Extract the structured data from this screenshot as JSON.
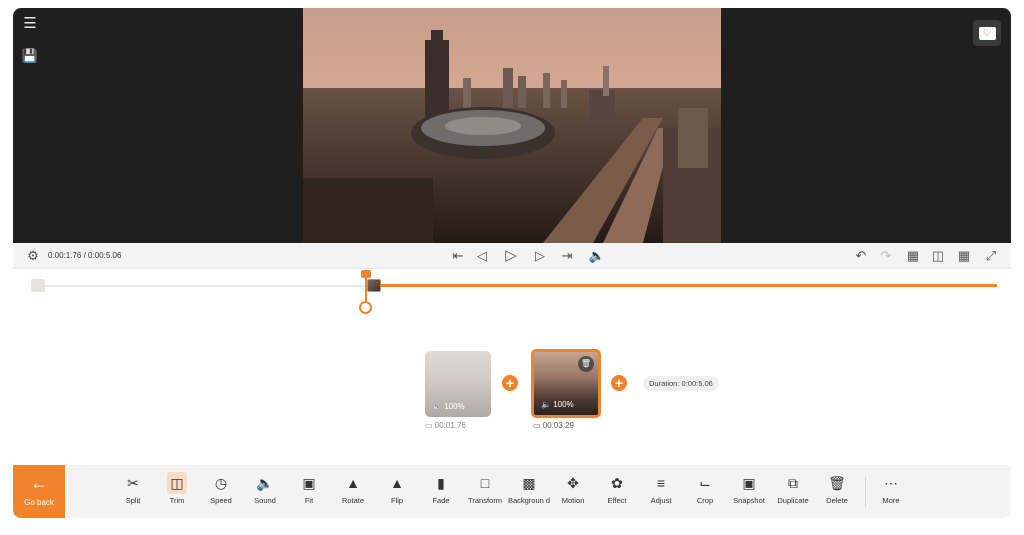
{
  "viewer": {
    "menu_icon": "hamburger-menu-icon",
    "save_icon": "save-icon",
    "feedback_icon": "feedback-heart-icon"
  },
  "controls": {
    "timecode": "0:00:1.76 / 0:00:5.06"
  },
  "timeline": {
    "clips": [
      {
        "volume_label": "100%",
        "duration": "00:01.76",
        "selected": false
      },
      {
        "volume_label": "100%",
        "duration": "00:03.29",
        "selected": true
      }
    ],
    "add_symbol": "+",
    "total_duration": "Duration: 0:00:5.06"
  },
  "toolbar": {
    "go_back_label": "Go back",
    "tools": [
      {
        "label": "Split",
        "icon": "scissors-icon"
      },
      {
        "label": "Trim",
        "icon": "trim-icon"
      },
      {
        "label": "Speed",
        "icon": "speedometer-icon"
      },
      {
        "label": "Sound",
        "icon": "speaker-icon"
      },
      {
        "label": "Fit",
        "icon": "fit-icon"
      },
      {
        "label": "Rotate",
        "icon": "rotate-icon"
      },
      {
        "label": "Flip",
        "icon": "flip-icon"
      },
      {
        "label": "Fade",
        "icon": "fade-icon"
      },
      {
        "label": "Transform",
        "icon": "transform-icon"
      },
      {
        "label": "Backgroun d",
        "icon": "background-icon"
      },
      {
        "label": "Motion",
        "icon": "motion-icon"
      },
      {
        "label": "Effect",
        "icon": "effect-icon"
      },
      {
        "label": "Adjust",
        "icon": "adjust-sliders-icon"
      },
      {
        "label": "Crop",
        "icon": "crop-icon"
      },
      {
        "label": "Snapshot",
        "icon": "camera-icon"
      },
      {
        "label": "Duplicate",
        "icon": "duplicate-icon"
      },
      {
        "label": "Delete",
        "icon": "trash-icon"
      },
      {
        "label": "More",
        "icon": "more-icon"
      }
    ],
    "active_tool": "Trim"
  }
}
